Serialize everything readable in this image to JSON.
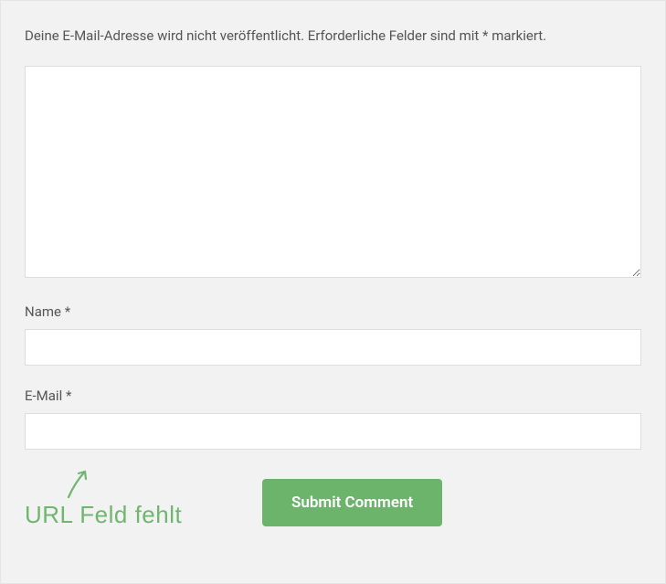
{
  "notice": "Deine E-Mail-Adresse wird nicht veröffentlicht. Erforderliche Felder sind mit * markiert.",
  "fields": {
    "comment": {
      "value": ""
    },
    "name": {
      "label": "Name *",
      "value": ""
    },
    "email": {
      "label": "E-Mail *",
      "value": ""
    }
  },
  "annotation": "URL Feld fehlt",
  "submit_label": "Submit Comment"
}
